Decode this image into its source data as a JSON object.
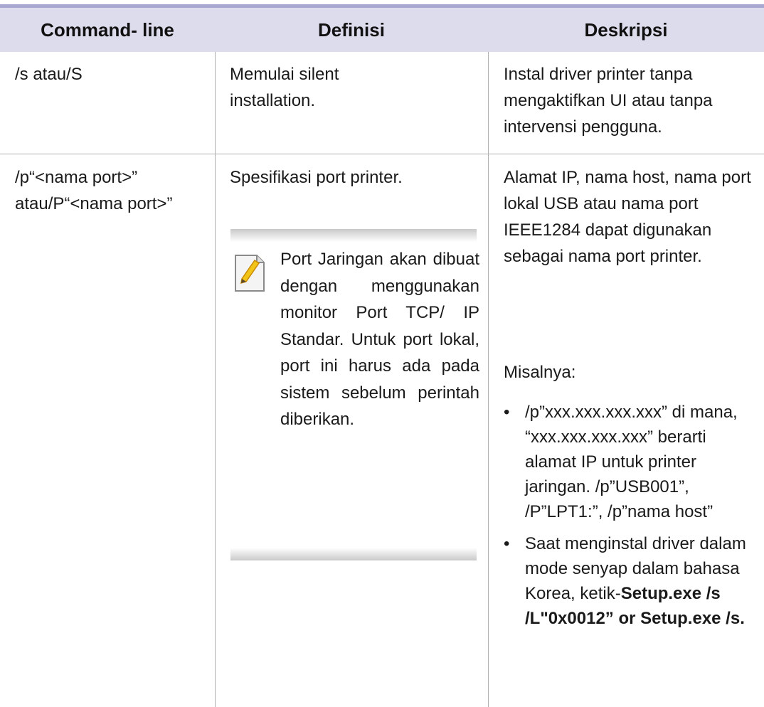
{
  "headers": [
    "Command- line",
    "Definisi",
    "Deskripsi"
  ],
  "rows": [
    {
      "command": "/s atau/S",
      "definition": "Memulai silent installation.",
      "description": "Instal driver printer tanpa mengaktifkan UI atau tanpa intervensi pengguna."
    },
    {
      "command": "/p“<nama port>” atau/P“<nama port>”",
      "definition": "Spesifikasi port printer.",
      "note": "Port Jaringan akan dibuat dengan menggunakan monitor Port TCP/ IP Standar. Untuk port lokal, port ini harus ada pada sistem sebelum perintah diberikan.",
      "description": "Alamat IP, nama host, nama port lokal USB atau nama port IEEE1284 dapat digunakan sebagai nama port printer.",
      "example_label": "Misalnya:",
      "bullets": [
        {
          "text": "/p”xxx.xxx.xxx.xxx” di mana, “xxx.xxx.xxx.xxx” berarti alamat IP untuk printer jaringan. /p”USB001”, /P”LPT1:”, /p”nama host”"
        },
        {
          "text_plain": "Saat menginstal driver dalam mode senyap dalam bahasa Korea, ketik-",
          "text_bold": "Setup.exe /s /L\"0x0012” or Setup.exe /s."
        }
      ]
    }
  ],
  "icons": {
    "note": "note-pencil-icon"
  },
  "colors": {
    "header_bg": "#dcdcec",
    "top_rule": "#a7a7cf",
    "grid": "#b0b0b0"
  }
}
